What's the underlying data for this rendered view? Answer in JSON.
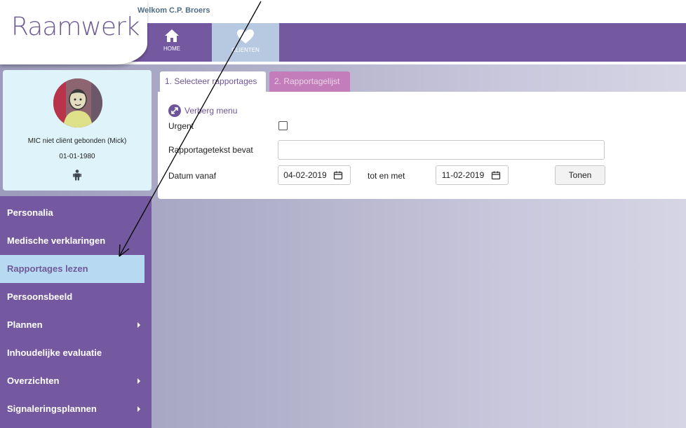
{
  "header": {
    "logo_text": "Raamwerk",
    "welcome": "Welkom C.P. Broers",
    "nav": [
      {
        "label": "HOME",
        "icon": "home-icon"
      },
      {
        "label": "CLIENTEN",
        "icon": "heart-icon"
      }
    ]
  },
  "profile": {
    "name": "MIC niet cliënt gebonden  (Mick)",
    "dob": "01-01-1980",
    "icon": "person-icon"
  },
  "sidebar": {
    "items": [
      {
        "label": "Personalia",
        "has_submenu": false
      },
      {
        "label": "Medische verklaringen",
        "has_submenu": false
      },
      {
        "label": "Rapportages lezen",
        "has_submenu": false,
        "active": true
      },
      {
        "label": "Persoonsbeeld",
        "has_submenu": false
      },
      {
        "label": "Plannen",
        "has_submenu": true
      },
      {
        "label": "Inhoudelijke evaluatie",
        "has_submenu": false
      },
      {
        "label": "Overzichten",
        "has_submenu": true
      },
      {
        "label": "Signaleringsplannen",
        "has_submenu": true
      }
    ]
  },
  "tabs": [
    {
      "label": "1. Selecteer rapportages",
      "active": true
    },
    {
      "label": "2. Rapportagelijst",
      "active": false
    }
  ],
  "form": {
    "hide_menu": "Verberg menu",
    "urgent_label": "Urgent",
    "urgent_checked": false,
    "text_label": "Rapportagetekst bevat",
    "text_value": "",
    "date_from_label": "Datum vanaf",
    "date_from": "04-02-2019",
    "date_to_label": "tot en met",
    "date_to": "11-02-2019",
    "submit_label": "Tonen"
  },
  "colors": {
    "brand_purple": "#7559a0",
    "active_menu_bg": "#b7d9f1",
    "tab_inactive": "#c47dbb",
    "profile_bg": "#dff3fb"
  }
}
